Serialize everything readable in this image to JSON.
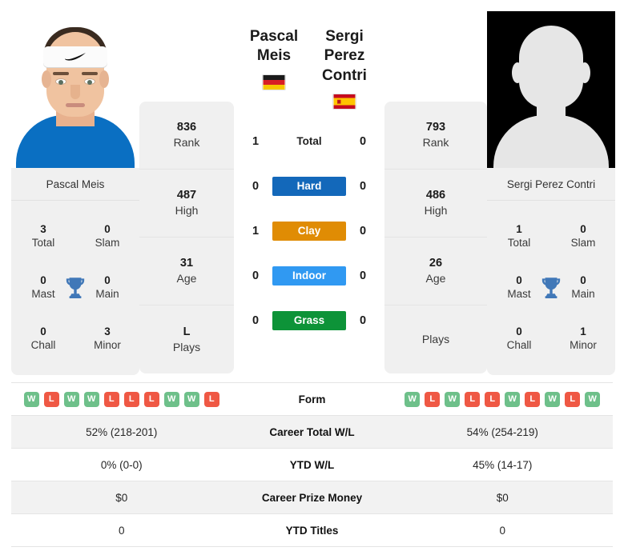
{
  "players": {
    "left": {
      "name": "Pascal Meis",
      "photo_caption": "Pascal Meis",
      "country": "Germany",
      "flag_icon": "flag-germany",
      "stats": [
        {
          "value": "836",
          "label": "Rank"
        },
        {
          "value": "487",
          "label": "High"
        },
        {
          "value": "31",
          "label": "Age"
        },
        {
          "value": "L",
          "label": "Plays"
        }
      ],
      "titles": [
        {
          "value": "3",
          "label": "Total"
        },
        {
          "value": "0",
          "label": "Slam"
        },
        {
          "value": "0",
          "label": "Mast"
        },
        {
          "value": "0",
          "label": "Main"
        },
        {
          "value": "0",
          "label": "Chall"
        },
        {
          "value": "3",
          "label": "Minor"
        }
      ],
      "form": [
        "W",
        "L",
        "W",
        "W",
        "L",
        "L",
        "L",
        "W",
        "W",
        "L"
      ],
      "career_total_wl": "52% (218-201)",
      "ytd_wl": "0% (0-0)",
      "career_prize_money": "$0",
      "ytd_titles": "0"
    },
    "right": {
      "name": "Sergi Perez Contri",
      "photo_caption": "Sergi Perez Contri",
      "country": "Spain",
      "flag_icon": "flag-spain",
      "stats": [
        {
          "value": "793",
          "label": "Rank"
        },
        {
          "value": "486",
          "label": "High"
        },
        {
          "value": "26",
          "label": "Age"
        },
        {
          "value": "",
          "label": "Plays"
        }
      ],
      "titles": [
        {
          "value": "1",
          "label": "Total"
        },
        {
          "value": "0",
          "label": "Slam"
        },
        {
          "value": "0",
          "label": "Mast"
        },
        {
          "value": "0",
          "label": "Main"
        },
        {
          "value": "0",
          "label": "Chall"
        },
        {
          "value": "1",
          "label": "Minor"
        }
      ],
      "form": [
        "W",
        "L",
        "W",
        "L",
        "L",
        "W",
        "L",
        "W",
        "L",
        "W"
      ],
      "career_total_wl": "54% (254-219)",
      "ytd_wl": "45% (14-17)",
      "career_prize_money": "$0",
      "ytd_titles": "0"
    }
  },
  "head_to_head": [
    {
      "label": "Total",
      "left": "1",
      "right": "0",
      "type": "plain",
      "color": ""
    },
    {
      "label": "Hard",
      "left": "0",
      "right": "0",
      "type": "badge",
      "color": "#1368ba"
    },
    {
      "label": "Clay",
      "left": "1",
      "right": "0",
      "type": "badge",
      "color": "#e08c04"
    },
    {
      "label": "Indoor",
      "left": "0",
      "right": "0",
      "type": "badge",
      "color": "#3099f2"
    },
    {
      "label": "Grass",
      "left": "0",
      "right": "0",
      "type": "badge",
      "color": "#0d9338"
    }
  ],
  "table_rows": [
    {
      "label": "Form",
      "key": "form",
      "type": "form"
    },
    {
      "label": "Career Total W/L",
      "key": "career_total_wl",
      "type": "text"
    },
    {
      "label": "YTD W/L",
      "key": "ytd_wl",
      "type": "text"
    },
    {
      "label": "Career Prize Money",
      "key": "career_prize_money",
      "type": "text"
    },
    {
      "label": "YTD Titles",
      "key": "ytd_titles",
      "type": "text"
    }
  ],
  "colors": {
    "win_badge": "#6ec08a",
    "loss_badge": "#ef5844",
    "card_bg": "#f0f0f0",
    "row_alt_bg": "#f2f2f2",
    "trophy": "#4178b8"
  },
  "icons": {
    "trophy": "trophy-icon"
  }
}
